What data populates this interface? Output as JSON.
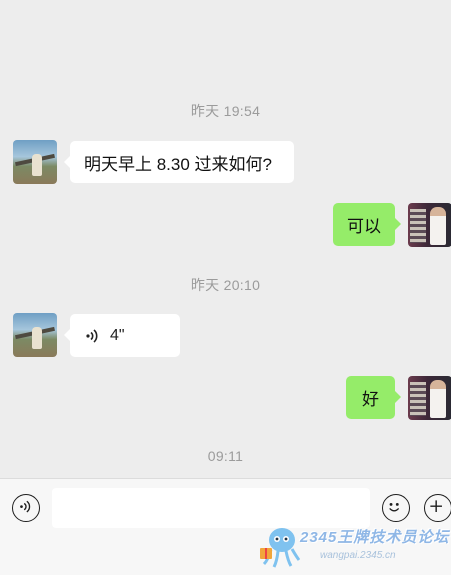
{
  "messages": [
    {
      "type": "time",
      "text": "昨天 19:54"
    },
    {
      "type": "text",
      "side": "left",
      "text": "明天早上 8.30 过来如何?"
    },
    {
      "type": "text",
      "side": "right",
      "text": "可以"
    },
    {
      "type": "time",
      "text": "昨天 20:10"
    },
    {
      "type": "voice",
      "side": "left",
      "duration": "4\""
    },
    {
      "type": "text",
      "side": "right",
      "text": "好"
    },
    {
      "type": "time",
      "text": "09:11"
    }
  ],
  "input": {
    "value": "",
    "placeholder": ""
  },
  "icons": {
    "voice_toggle": "voice-icon",
    "emoji": "emoji-icon",
    "more": "plus-icon"
  },
  "colors": {
    "background": "#ededed",
    "bubble_self": "#95ec69",
    "bubble_other": "#ffffff",
    "timestamp": "#9b9b9b"
  },
  "watermark": {
    "title": "2345王牌技术员论坛",
    "url": "wangpai.2345.cn"
  }
}
